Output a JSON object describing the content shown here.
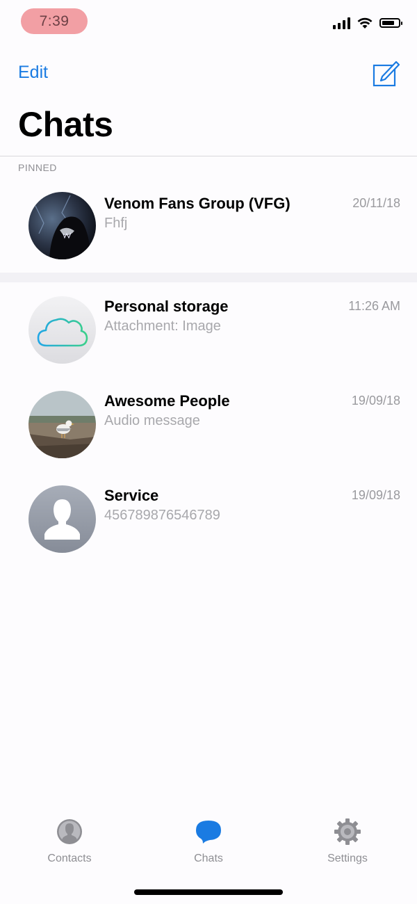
{
  "status_bar": {
    "time": "7:39"
  },
  "nav": {
    "edit_label": "Edit",
    "compose_icon": "compose-icon"
  },
  "title": "Chats",
  "section": {
    "pinned_label": "PINNED"
  },
  "chats": [
    {
      "name": "Venom Fans Group (VFG)",
      "preview": "Fhfj",
      "date": "20/11/18",
      "avatar": "venom-photo",
      "pinned": true
    },
    {
      "name": "Personal storage",
      "preview": "Attachment: Image",
      "date": "11:26 AM",
      "avatar": "cloud-icon",
      "pinned": false
    },
    {
      "name": "Awesome People",
      "preview": "Audio message",
      "date": "19/09/18",
      "avatar": "seagull-photo",
      "pinned": false
    },
    {
      "name": "Service",
      "preview": "456789876546789",
      "date": "19/09/18",
      "avatar": "person-silhouette-icon",
      "pinned": false
    }
  ],
  "tabs": [
    {
      "label": "Contacts",
      "icon": "contacts-icon",
      "active": false
    },
    {
      "label": "Chats",
      "icon": "chat-bubble-icon",
      "active": true
    },
    {
      "label": "Settings",
      "icon": "gear-icon",
      "active": false
    }
  ],
  "colors": {
    "accent": "#1a7be2",
    "active_tab_icon": "#1a7be2",
    "inactive_tab": "#8e8e93",
    "time_pill": "#f29fa4"
  }
}
